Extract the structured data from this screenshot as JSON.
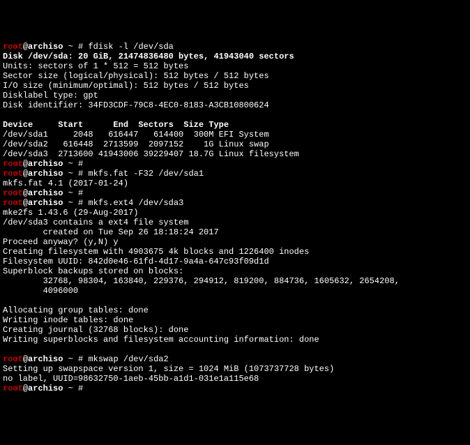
{
  "prompt": {
    "user": "root",
    "at": "@",
    "host": "archiso",
    "sep": " ~ # "
  },
  "commands": {
    "fdisk": "fdisk -l /dev/sda",
    "empty1": "",
    "mkfs_fat": "mkfs.fat -F32 /dev/sda1",
    "empty2": "",
    "mkfs_ext4": "mkfs.ext4 /dev/sda3",
    "mkswap": "mkswap /dev/sda2",
    "empty3": ""
  },
  "fdisk_output": {
    "l1": "Disk /dev/sda: 20 GiB, 21474836480 bytes, 41943040 sectors",
    "l2": "Units: sectors of 1 * 512 = 512 bytes",
    "l3": "Sector size (logical/physical): 512 bytes / 512 bytes",
    "l4": "I/O size (minimum/optimal): 512 bytes / 512 bytes",
    "l5": "Disklabel type: gpt",
    "l6": "Disk identifier: 34FD3CDF-79C8-4EC0-8183-A3CB10800624",
    "header": "Device     Start      End  Sectors  Size Type",
    "r1": "/dev/sda1     2048   616447   614400  300M EFI System",
    "r2": "/dev/sda2   616448  2713599  2097152    1G Linux swap",
    "r3": "/dev/sda3  2713600 41943006 39229407 18.7G Linux filesystem"
  },
  "mkfs_fat_output": {
    "l1": "mkfs.fat 4.1 (2017-01-24)"
  },
  "mkfs_ext4_output": {
    "l1": "mke2fs 1.43.6 (29-Aug-2017)",
    "l2": "/dev/sda3 contains a ext4 file system",
    "l3": "        created on Tue Sep 26 18:18:24 2017",
    "l4": "Proceed anyway? (y,N) y",
    "l5": "Creating filesystem with 4903675 4k blocks and 1226400 inodes",
    "l6": "Filesystem UUID: 842d0e46-61fd-4d17-9a4a-647c93f09d1d",
    "l7": "Superblock backups stored on blocks:",
    "l8": "        32768, 98304, 163840, 229376, 294912, 819200, 884736, 1605632, 2654208,",
    "l9": "        4096000",
    "l10": "Allocating group tables: done",
    "l11": "Writing inode tables: done",
    "l12": "Creating journal (32768 blocks): done",
    "l13": "Writing superblocks and filesystem accounting information: done"
  },
  "mkswap_output": {
    "l1": "Setting up swapspace version 1, size = 1024 MiB (1073737728 bytes)",
    "l2": "no label, UUID=98632750-1aeb-45bb-a1d1-031e1a115e68"
  }
}
